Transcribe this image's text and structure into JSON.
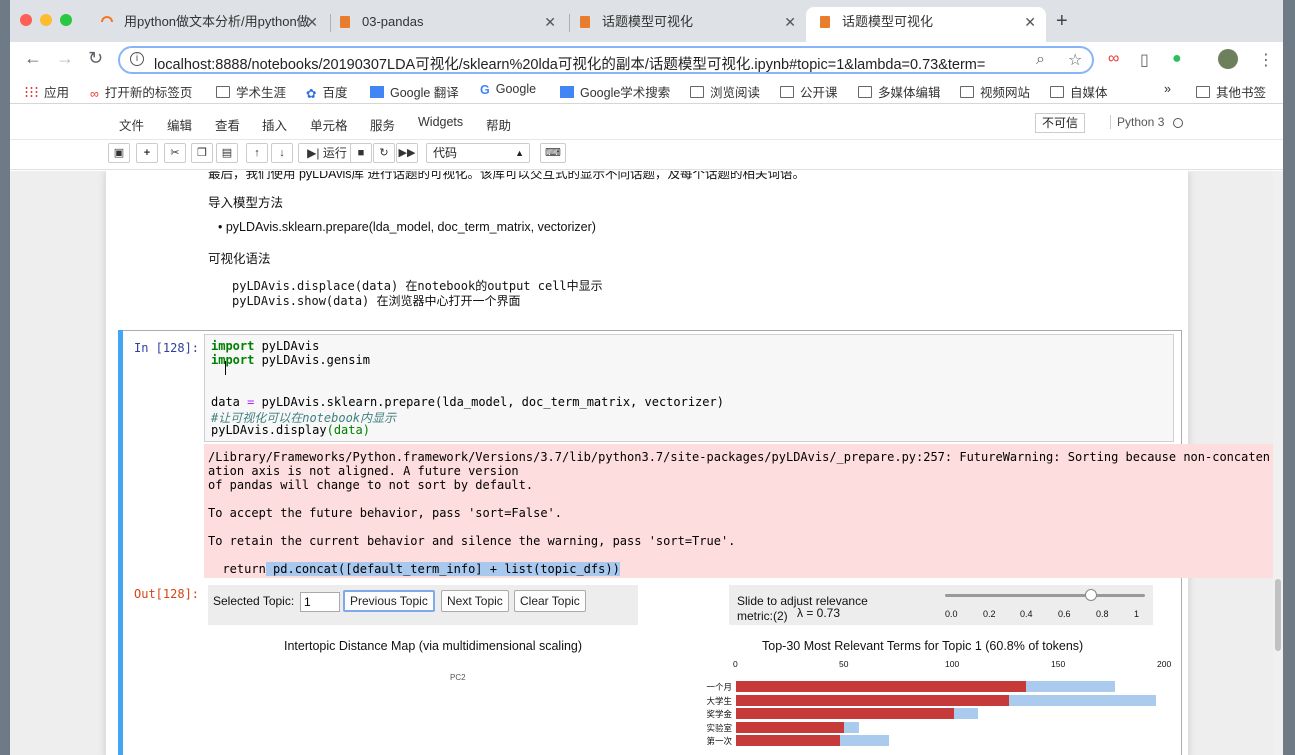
{
  "browser": {
    "tabs": [
      {
        "title": "用python做文本分析/用python做",
        "active": false
      },
      {
        "title": "03-pandas",
        "active": false
      },
      {
        "title": "话题模型可视化",
        "active": false
      },
      {
        "title": "话题模型可视化",
        "active": true
      }
    ],
    "url": "localhost:8888/notebooks/20190307LDA可视化/sklearn%20lda可视化的副本/话题模型可视化.ipynb#topic=1&lambda=0.73&term=",
    "bookmarks": [
      "应用",
      "打开新的标签页",
      "学术生涯",
      "百度",
      "Google 翻译",
      "Google",
      "Google学术搜索",
      "浏览阅读",
      "公开课",
      "多媒体编辑",
      "视频网站",
      "自媒体",
      "»",
      "其他书签"
    ]
  },
  "jupyter": {
    "menus": [
      "文件",
      "编辑",
      "查看",
      "插入",
      "单元格",
      "服务",
      "Widgets",
      "帮助"
    ],
    "trust": "不可信",
    "kernel": "Python 3",
    "toolbar": {
      "run": "运行",
      "cell_type": "代码"
    }
  },
  "markdown": {
    "line1": "最后，我们使用 pyLDAvis库 进行话题的可视化。该库可以交互式的显示不同话题，及每个话题的相关词语。",
    "line2": "导入模型方法",
    "bullet": "pyLDAvis.sklearn.prepare(lda_model, doc_term_matrix, vectorizer)",
    "line3": "可视化语法",
    "code1": "pyLDAvis.displace(data) 在notebook的output cell中显示",
    "code2": "pyLDAvis.show(data)  在浏览器中心打开一个界面"
  },
  "cell": {
    "in_prompt": "In [128]:",
    "out_prompt": "Out[128]:",
    "code": {
      "l1_kw": "import",
      "l1_rest": " pyLDAvis",
      "l2_kw": "import",
      "l2_rest": " pyLDAvis.gensim",
      "l3_a": "data ",
      "l3_eq": "=",
      "l3_b": " pyLDAvis.sklearn.prepare(lda_model, doc_term_matrix, vectorizer)",
      "l4": "#让可视化可以在notebook内显示",
      "l5_a": "pyLDAvis.display",
      "l5_b": "(data)"
    },
    "stderr": {
      "l1": "/Library/Frameworks/Python.framework/Versions/3.7/lib/python3.7/site-packages/pyLDAvis/_prepare.py:257: FutureWarning: Sorting because non-concaten",
      "l2": "ation axis is not aligned. A future version",
      "l3": "of pandas will change to not sort by default.",
      "l4": "To accept the future behavior, pass 'sort=False'.",
      "l5": "To retain the current behavior and silence the warning, pass 'sort=True'.",
      "l6_a": "  return",
      "l6_b": " pd.concat([default_term_info] + list(topic_dfs))"
    }
  },
  "ldavis": {
    "selected_topic_label": "Selected Topic:",
    "selected_topic_value": "1",
    "prev": "Previous Topic",
    "next": "Next Topic",
    "clear": "Clear Topic",
    "relevance_label": "Slide to adjust relevance",
    "metric_label": "metric:(2)",
    "lambda_label": "λ = 0.73",
    "lambda": 0.73,
    "slider_ticks": [
      "0.0",
      "0.2",
      "0.4",
      "0.6",
      "0.8",
      "1"
    ],
    "map_title": "Intertopic Distance Map (via multidimensional scaling)",
    "pc2": "PC2"
  },
  "chart_data": {
    "type": "bar",
    "title": "Top-30 Most Relevant Terms for Topic 1 (60.8% of tokens)",
    "xlim": [
      0,
      200
    ],
    "x_ticks": [
      "0",
      "50",
      "100",
      "150",
      "200"
    ],
    "categories": [
      "一个月",
      "大学生",
      "奖学金",
      "实验室",
      "第一次"
    ],
    "series": [
      {
        "role": "overall",
        "values": [
          179,
          198,
          114,
          58,
          72
        ],
        "color": "#aacbed"
      },
      {
        "role": "topic",
        "values": [
          137,
          129,
          103,
          51,
          49
        ],
        "color": "#c63a3a"
      }
    ]
  }
}
